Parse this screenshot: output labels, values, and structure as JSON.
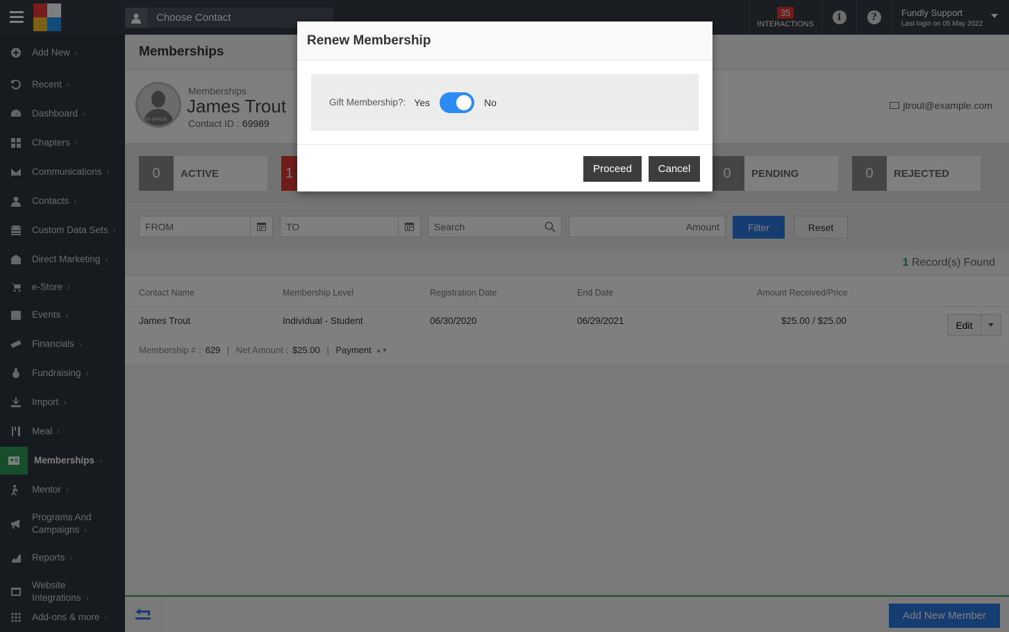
{
  "topbar": {
    "choose_contact": "Choose Contact",
    "interactions_count": "35",
    "interactions_label": "INTERACTIONS",
    "user_name": "Fundly Support",
    "last_login": "Last login on 05 May 2022"
  },
  "sidebar": {
    "items": [
      {
        "label": "Add New",
        "icon": "plus-circle-icon"
      },
      {
        "label": "Recent",
        "icon": "history-icon"
      },
      {
        "label": "Dashboard",
        "icon": "dashboard-icon"
      },
      {
        "label": "Chapters",
        "icon": "grid-icon"
      },
      {
        "label": "Communications",
        "icon": "envelope-icon"
      },
      {
        "label": "Contacts",
        "icon": "user-icon"
      },
      {
        "label": "Custom Data Sets",
        "icon": "database-icon"
      },
      {
        "label": "Direct Marketing",
        "icon": "building-icon"
      },
      {
        "label": "e-Store",
        "icon": "cart-icon"
      },
      {
        "label": "Events",
        "icon": "calendar-icon"
      },
      {
        "label": "Financials",
        "icon": "money-icon"
      },
      {
        "label": "Fundraising",
        "icon": "money-bag-icon"
      },
      {
        "label": "Import",
        "icon": "import-icon"
      },
      {
        "label": "Meal",
        "icon": "cutlery-icon"
      },
      {
        "label": "Memberships",
        "icon": "id-card-icon"
      },
      {
        "label": "Mentor",
        "icon": "mentor-icon"
      },
      {
        "label": "Programs And Campaigns",
        "icon": "megaphone-icon"
      },
      {
        "label": "Reports",
        "icon": "chart-icon"
      },
      {
        "label": "Website Integrations",
        "icon": "window-icon"
      },
      {
        "label": "Add-ons & more",
        "icon": "apps-icon"
      }
    ]
  },
  "page": {
    "title": "Memberships",
    "contact_sub": "Memberships",
    "contact_name": "James Trout",
    "contact_id_label": "Contact ID :",
    "contact_id": "69989",
    "email": "jtrout@example.com",
    "avatar_text": "NO IMAGE"
  },
  "status": [
    {
      "count": "0",
      "label": "ACTIVE"
    },
    {
      "count": "1",
      "label": ""
    },
    {
      "count": "0",
      "label": "PENDING"
    },
    {
      "count": "0",
      "label": "REJECTED"
    }
  ],
  "filters": {
    "from_placeholder": "FROM",
    "to_placeholder": "TO",
    "search_placeholder": "Search",
    "amount_placeholder": "Amount",
    "filter_label": "Filter",
    "reset_label": "Reset"
  },
  "records": {
    "count": "1",
    "label": "Record(s) Found"
  },
  "table": {
    "headers": [
      "Contact Name",
      "Membership Level",
      "Registration Date",
      "End Date",
      "Amount Received/Price"
    ],
    "row": {
      "contact_name": "James Trout",
      "level": "Individual - Student",
      "reg_date": "06/30/2020",
      "end_date": "06/29/2021",
      "amount": "$25.00 / $25.00",
      "edit_label": "Edit",
      "membership_no_label": "Membership # :",
      "membership_no": "629",
      "net_amount_label": "Net Amount :",
      "net_amount": "$25.00",
      "payment_label": "Payment"
    }
  },
  "footer": {
    "add_member_label": "Add New Member"
  },
  "modal": {
    "title": "Renew Membership",
    "gift_label": "Gift Membership?:",
    "yes_label": "Yes",
    "no_label": "No",
    "toggle_state": "No",
    "proceed_label": "Proceed",
    "cancel_label": "Cancel"
  },
  "colors": {
    "accent_blue": "#2c7be5",
    "accent_green": "#2e9e5b",
    "sidebar_bg": "#2f3640",
    "topbar_bg": "#343b45",
    "alert_red": "#e53935"
  }
}
